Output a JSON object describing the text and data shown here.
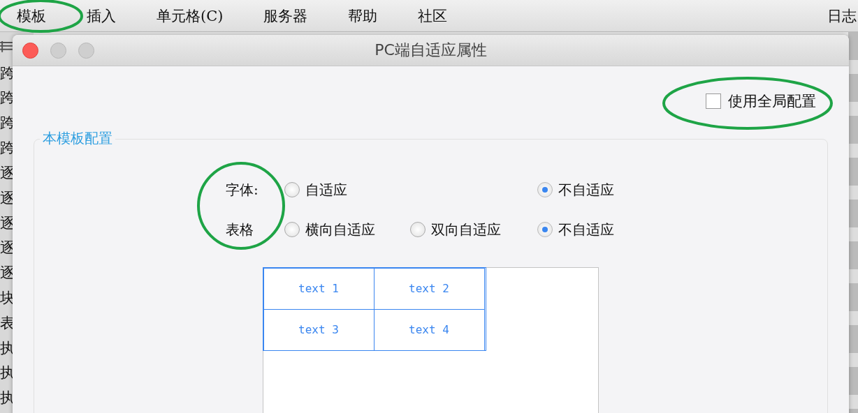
{
  "menu_bar": {
    "items": [
      "模板",
      "插入",
      "单元格(C)",
      "服务器",
      "帮助",
      "社区"
    ],
    "right_item": "日志"
  },
  "background_list": [
    "跨",
    "跨",
    "跨",
    "跨",
    "逐",
    "逐",
    "逐",
    "逐",
    "逐",
    "块",
    "表",
    "执",
    "执",
    "执"
  ],
  "window": {
    "title": "PC端自适应属性"
  },
  "global_config": {
    "label": "使用全局配置",
    "checked": false
  },
  "section": {
    "title": "本模板配置",
    "groups": [
      {
        "label": "字体:",
        "options": [
          {
            "label": "自适应",
            "selected": false
          },
          {
            "label": "不自适应",
            "selected": true
          }
        ]
      },
      {
        "label": "表格",
        "options": [
          {
            "label": "横向自适应",
            "selected": false
          },
          {
            "label": "双向自适应",
            "selected": false
          },
          {
            "label": "不自适应",
            "selected": true
          }
        ]
      }
    ]
  },
  "preview": {
    "cells": [
      "text 1",
      "text 2",
      "text 3",
      "text 4"
    ]
  }
}
